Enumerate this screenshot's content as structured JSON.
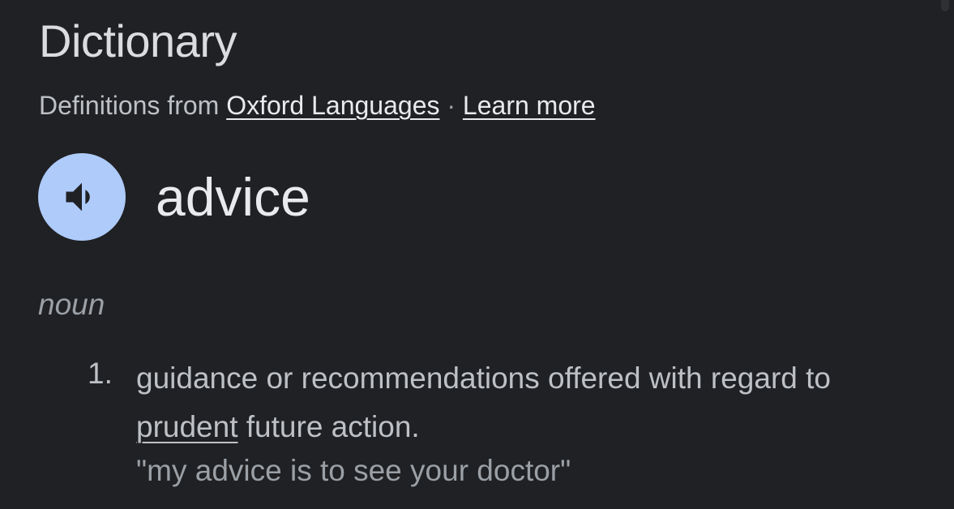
{
  "header": {
    "title": "Dictionary",
    "source_prefix": "Definitions from",
    "source_link": "Oxford Languages",
    "separator": "·",
    "learn_more": "Learn more"
  },
  "entry": {
    "word": "advice",
    "audio_icon": "speaker-icon",
    "part_of_speech": "noun",
    "definitions": [
      {
        "number": "1.",
        "text_before": "guidance or recommendations offered with regard to ",
        "linked_word": "prudent",
        "text_after": " future action.",
        "example": "\"my advice is to see your doctor\""
      }
    ]
  },
  "colors": {
    "background": "#202124",
    "audio_button": "#aecbfa",
    "primary_text": "#e8eaed",
    "secondary_text": "#bdc1c6",
    "muted_text": "#9aa0a6"
  }
}
